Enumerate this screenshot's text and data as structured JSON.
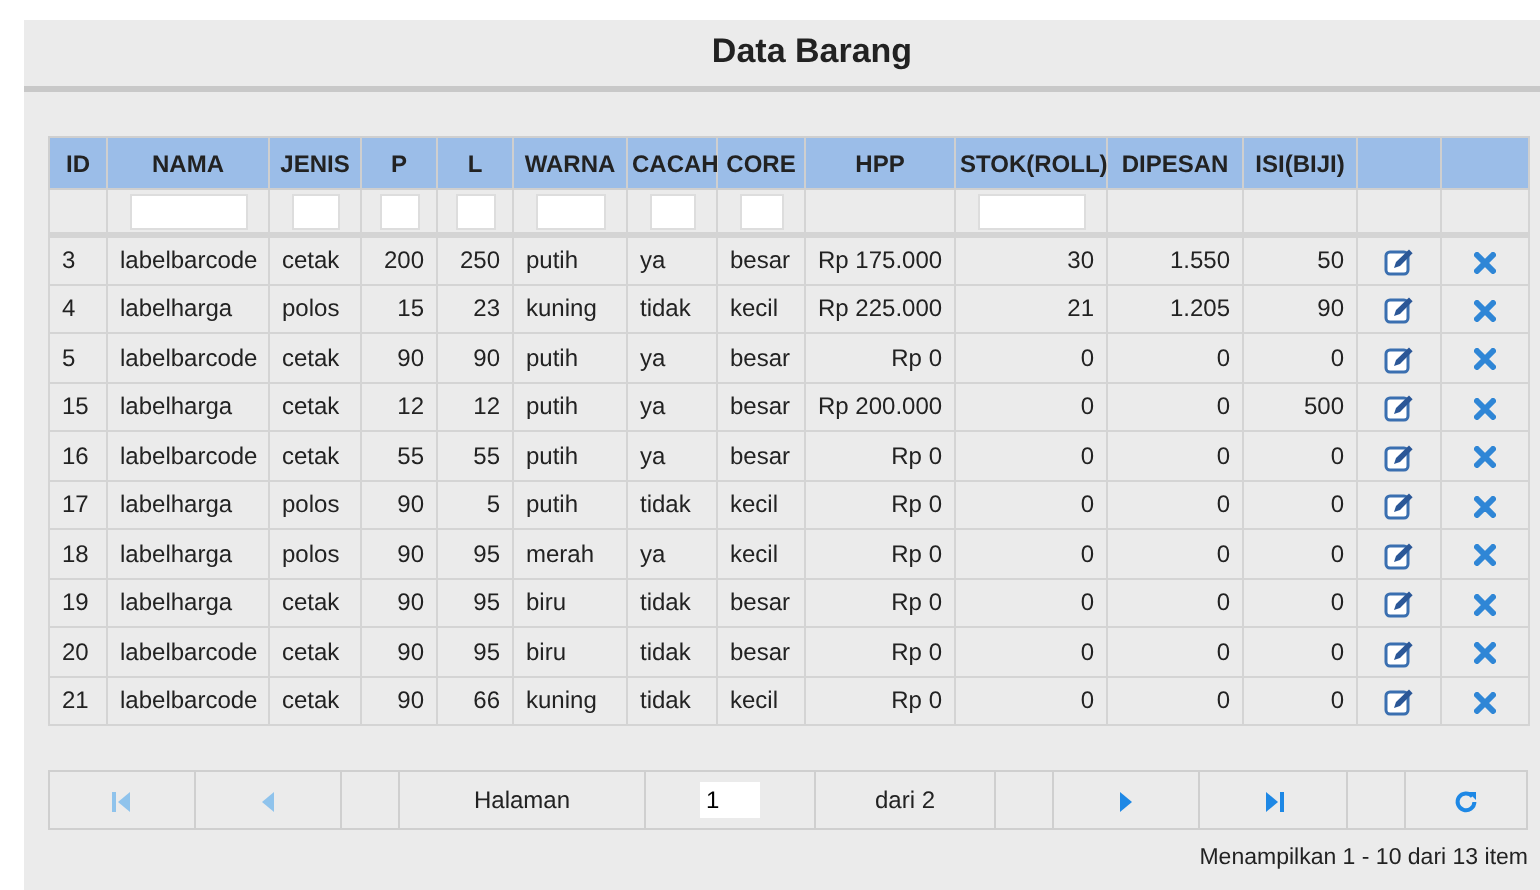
{
  "title": "Data Barang",
  "columns": [
    {
      "label": "ID",
      "filter": false,
      "numeric": false
    },
    {
      "label": "NAMA",
      "filter": true,
      "numeric": false
    },
    {
      "label": "JENIS",
      "filter": true,
      "numeric": false
    },
    {
      "label": "P",
      "filter": true,
      "numeric": true
    },
    {
      "label": "L",
      "filter": true,
      "numeric": true
    },
    {
      "label": "WARNA",
      "filter": true,
      "numeric": false
    },
    {
      "label": "CACAH",
      "filter": true,
      "numeric": false
    },
    {
      "label": "CORE",
      "filter": true,
      "numeric": false
    },
    {
      "label": "HPP",
      "filter": false,
      "numeric": true
    },
    {
      "label": "STOK(ROLL)",
      "filter": true,
      "numeric": true
    },
    {
      "label": "DIPESAN",
      "filter": false,
      "numeric": true
    },
    {
      "label": "ISI(BIJI)",
      "filter": false,
      "numeric": true
    }
  ],
  "rows": [
    [
      "3",
      "labelbarcode",
      "cetak",
      "200",
      "250",
      "putih",
      "ya",
      "besar",
      "Rp 175.000",
      "30",
      "1.550",
      "50"
    ],
    [
      "4",
      "labelharga",
      "polos",
      "15",
      "23",
      "kuning",
      "tidak",
      "kecil",
      "Rp 225.000",
      "21",
      "1.205",
      "90"
    ],
    [
      "5",
      "labelbarcode",
      "cetak",
      "90",
      "90",
      "putih",
      "ya",
      "besar",
      "Rp 0",
      "0",
      "0",
      "0"
    ],
    [
      "15",
      "labelharga",
      "cetak",
      "12",
      "12",
      "putih",
      "ya",
      "besar",
      "Rp 200.000",
      "0",
      "0",
      "500"
    ],
    [
      "16",
      "labelbarcode",
      "cetak",
      "55",
      "55",
      "putih",
      "ya",
      "besar",
      "Rp 0",
      "0",
      "0",
      "0"
    ],
    [
      "17",
      "labelharga",
      "polos",
      "90",
      "5",
      "putih",
      "tidak",
      "kecil",
      "Rp 0",
      "0",
      "0",
      "0"
    ],
    [
      "18",
      "labelharga",
      "polos",
      "90",
      "95",
      "merah",
      "ya",
      "kecil",
      "Rp 0",
      "0",
      "0",
      "0"
    ],
    [
      "19",
      "labelharga",
      "cetak",
      "90",
      "95",
      "biru",
      "tidak",
      "besar",
      "Rp 0",
      "0",
      "0",
      "0"
    ],
    [
      "20",
      "labelbarcode",
      "cetak",
      "90",
      "95",
      "biru",
      "tidak",
      "besar",
      "Rp 0",
      "0",
      "0",
      "0"
    ],
    [
      "21",
      "labelbarcode",
      "cetak",
      "90",
      "66",
      "kuning",
      "tidak",
      "kecil",
      "Rp 0",
      "0",
      "0",
      "0"
    ]
  ],
  "pager": [
    {
      "kind": "first",
      "disabled": true
    },
    {
      "kind": "prev",
      "disabled": true
    },
    {
      "kind": "sep"
    },
    {
      "kind": "text",
      "text": "Halaman"
    },
    {
      "kind": "input",
      "value": "1"
    },
    {
      "kind": "text",
      "text": "dari 2"
    },
    {
      "kind": "sep"
    },
    {
      "kind": "next",
      "disabled": false
    },
    {
      "kind": "last",
      "disabled": false
    },
    {
      "kind": "sep"
    },
    {
      "kind": "refresh",
      "disabled": false
    }
  ],
  "status": "Menampilkan 1 - 10 dari 13 item"
}
